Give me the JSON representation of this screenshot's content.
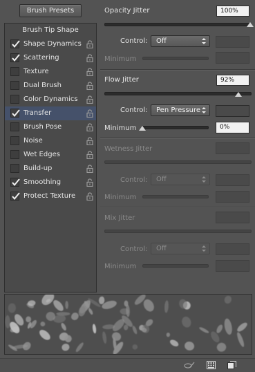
{
  "brush_presets_label": "Brush Presets",
  "tip_shape_label": "Brush Tip Shape",
  "options": [
    {
      "label": "Shape Dynamics",
      "checked": true
    },
    {
      "label": "Scattering",
      "checked": true
    },
    {
      "label": "Texture",
      "checked": false
    },
    {
      "label": "Dual Brush",
      "checked": false
    },
    {
      "label": "Color Dynamics",
      "checked": false
    },
    {
      "label": "Transfer",
      "checked": true,
      "selected": true
    },
    {
      "label": "Brush Pose",
      "checked": false
    },
    {
      "label": "Noise",
      "checked": false
    },
    {
      "label": "Wet Edges",
      "checked": false
    },
    {
      "label": "Build-up",
      "checked": false
    },
    {
      "label": "Smoothing",
      "checked": true
    },
    {
      "label": "Protect Texture",
      "checked": true
    }
  ],
  "opacity": {
    "label": "Opacity Jitter",
    "value": "100%",
    "level": 1.0,
    "control_label": "Control:",
    "control_value": "Off",
    "minimum_label": "Minimum"
  },
  "flow": {
    "label": "Flow Jitter",
    "value": "92%",
    "level": 0.92,
    "control_label": "Control:",
    "control_value": "Pen Pressure",
    "minimum_label": "Minimum",
    "minimum_value": "0%",
    "minimum_level": 0.0
  },
  "wetness": {
    "label": "Wetness Jitter",
    "control_label": "Control:",
    "control_value": "Off",
    "minimum_label": "Minimum"
  },
  "mix": {
    "label": "Mix Jitter",
    "control_label": "Control:",
    "control_value": "Off",
    "minimum_label": "Minimum"
  },
  "colors": {
    "selected_row": "#45516a",
    "accent_field": "#f2f2f2"
  }
}
